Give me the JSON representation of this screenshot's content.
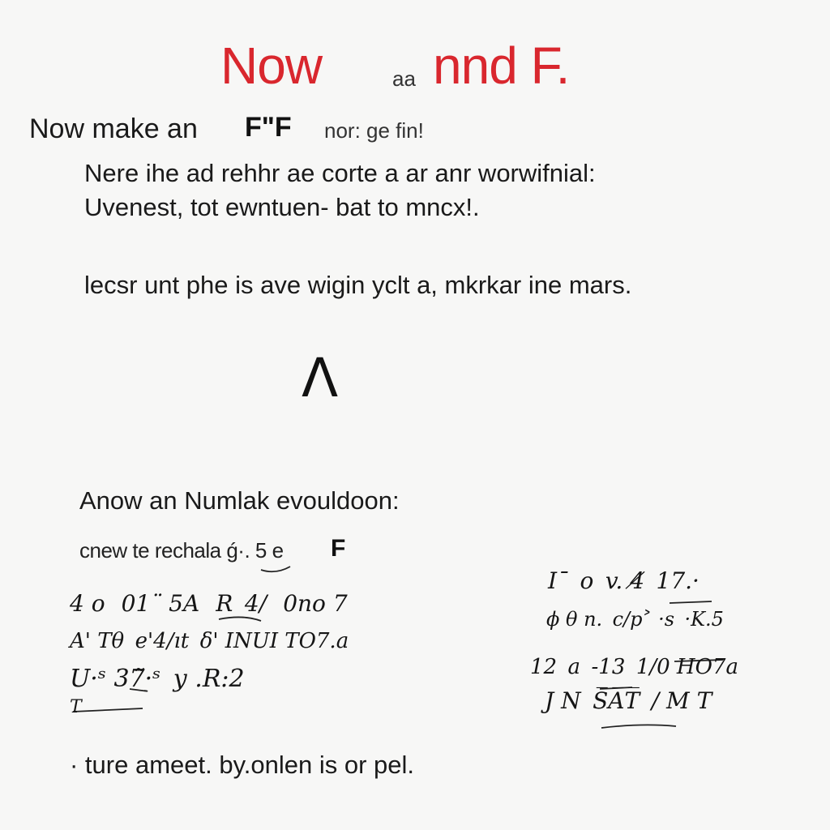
{
  "title": {
    "main": "Now",
    "small": "aa",
    "end": "nnd F."
  },
  "subtitle": {
    "part_a": "Now make an",
    "part_ff": "FʺF",
    "part_b": "nor: ge fin!"
  },
  "paragraphs": {
    "line_1a": "Nere ihe ad rehhr ae corte a ar anr worwifnial:",
    "line_1b": "Uvenest, tot ewntuen- bat to mncx!.",
    "line_2": "lecsr unt phe is ave wigin yclt a, mkrkar ine mars."
  },
  "caret_mark": "Λ",
  "section": {
    "heading": "Anow an Numlak evouldoon:",
    "sub": "cnew te rechala ǵ·. 5 e",
    "sub_f": "F"
  },
  "handwritten_left": {
    "line_1": "4 o   01¨ 5A   R  4/   0no 7",
    "line_2": "A' Tθ  e'4/ıt  δ' INUI TO7.a",
    "line_3": "U·ˢ 37̃·ˢ  y .R:2",
    "line_4": "T"
  },
  "handwritten_right": {
    "line_1": "Iˉ  o  v. 4̸  17.· ",
    "line_2": "ϕ θ n.  c/p˃ ·s  ·K.5",
    "line_3": "12  a  -13  1/0 HO7a",
    "line_4": "J N  S̅A̅T̅  / M T"
  },
  "footer": "· ture ameet. by.onlen is or pel."
}
